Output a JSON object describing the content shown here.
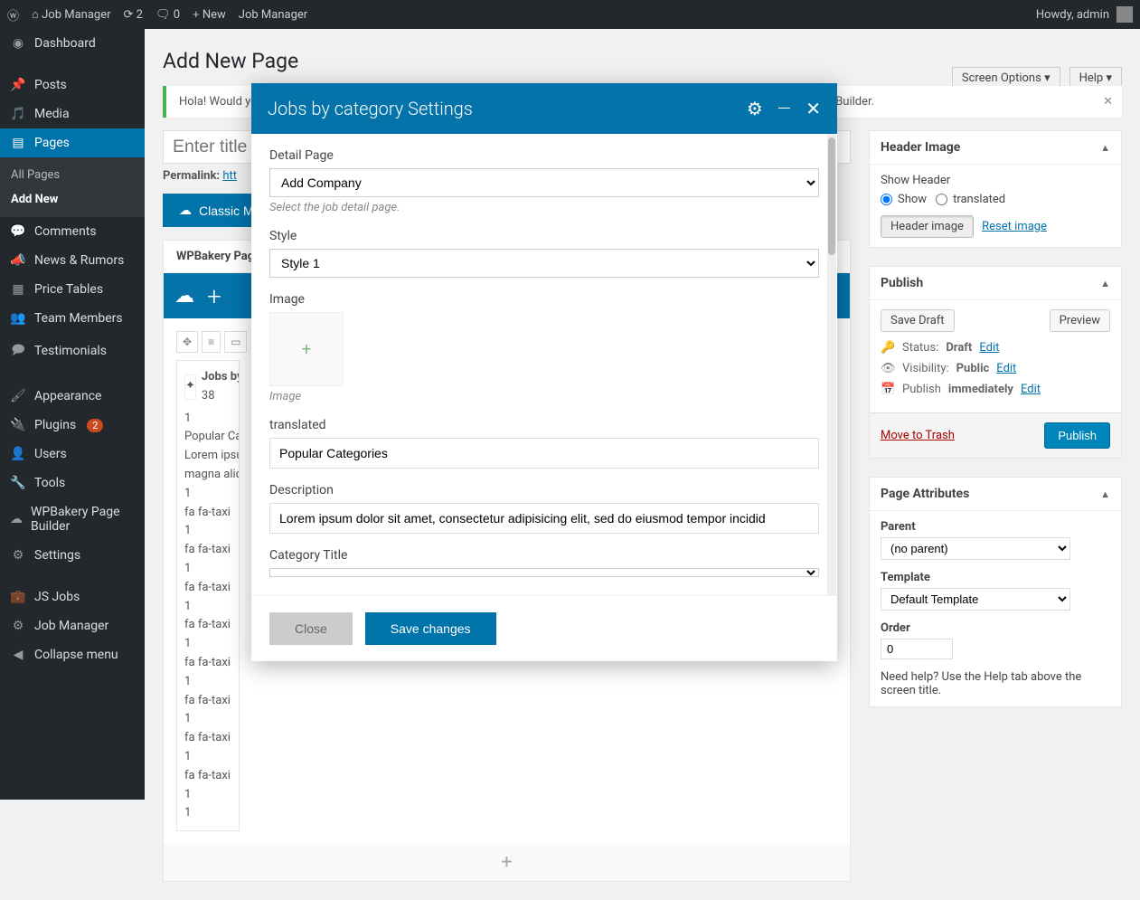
{
  "adminbar": {
    "site": "Job Manager",
    "updates": "2",
    "comments": "0",
    "new": "New",
    "page": "Job Manager",
    "howdy": "Howdy, admin"
  },
  "sidebar": {
    "items": [
      {
        "icon": "⊘",
        "label": "Dashboard"
      },
      {
        "icon": "✎",
        "label": "Posts"
      },
      {
        "icon": "🖼",
        "label": "Media"
      },
      {
        "icon": "▤",
        "label": "Pages"
      },
      {
        "icon": "💬",
        "label": "Comments"
      },
      {
        "icon": "📢",
        "label": "News & Rumors"
      },
      {
        "icon": "▦",
        "label": "Price Tables"
      },
      {
        "icon": "👥",
        "label": "Team Members"
      },
      {
        "icon": "🗩",
        "label": "Testimonials"
      },
      {
        "icon": "🖌",
        "label": "Appearance"
      },
      {
        "icon": "🔌",
        "label": "Plugins",
        "badge": "2"
      },
      {
        "icon": "👤",
        "label": "Users"
      },
      {
        "icon": "🔧",
        "label": "Tools"
      },
      {
        "icon": "☁",
        "label": "WPBakery Page Builder"
      },
      {
        "icon": "⚙",
        "label": "Settings"
      },
      {
        "icon": "💼",
        "label": "JS Jobs"
      },
      {
        "icon": "⚙",
        "label": "Job Manager"
      },
      {
        "icon": "◀",
        "label": "Collapse menu"
      }
    ],
    "sub_all": "All Pages",
    "sub_add": "Add New"
  },
  "page": {
    "title": "Add New Page",
    "notice": "Hola! Would you like to receive automatic updates and unlock premium support? Please activate your copy of WPBakery Page Builder.",
    "title_placeholder": "Enter title here",
    "permalink_label": "Permalink:",
    "permalink_url": "htt",
    "classic_mode": "Classic Mode",
    "screen_options": "Screen Options",
    "help": "Help"
  },
  "vc": {
    "panel_title": "WPBakery Page Builder",
    "element_title": "Jobs by category",
    "element_sub": "38",
    "lines": [
      "1",
      "Popular Categories",
      "Lorem ipsum dolor",
      "magna aliqua",
      "1",
      "fa fa-taxi",
      "1",
      "fa fa-taxi",
      "1",
      "fa fa-taxi",
      "1",
      "fa fa-taxi",
      "1",
      "fa fa-taxi",
      "1",
      "fa fa-taxi",
      "1",
      "fa fa-taxi",
      "1",
      "fa fa-taxi",
      "1",
      "1"
    ]
  },
  "modal": {
    "title": "Jobs by category Settings",
    "detail_page_label": "Detail Page",
    "detail_page_value": "Add Company",
    "detail_page_help": "Select the job detail page.",
    "style_label": "Style",
    "style_value": "Style 1",
    "image_label": "Image",
    "image_help": "Image",
    "translated_label": "translated",
    "translated_value": "Popular Categories",
    "description_label": "Description",
    "description_value": "Lorem ipsum dolor sit amet, consectetur adipisicing elit, sed do eiusmod tempor incidid",
    "cat_title_label": "Category Title",
    "close": "Close",
    "save": "Save changes"
  },
  "header_image": {
    "title": "Header Image",
    "show_header": "Show Header",
    "opt_show": "Show",
    "opt_translated": "translated",
    "btn": "Header image",
    "reset": "Reset image"
  },
  "publish": {
    "title": "Publish",
    "save_draft": "Save Draft",
    "preview": "Preview",
    "status_label": "Status:",
    "status_value": "Draft",
    "vis_label": "Visibility:",
    "vis_value": "Public",
    "pub_label": "Publish",
    "pub_value": "immediately",
    "edit": "Edit",
    "trash": "Move to Trash",
    "publish_btn": "Publish"
  },
  "attrs": {
    "title": "Page Attributes",
    "parent_label": "Parent",
    "parent_value": "(no parent)",
    "template_label": "Template",
    "template_value": "Default Template",
    "order_label": "Order",
    "order_value": "0",
    "help": "Need help? Use the Help tab above the screen title."
  }
}
